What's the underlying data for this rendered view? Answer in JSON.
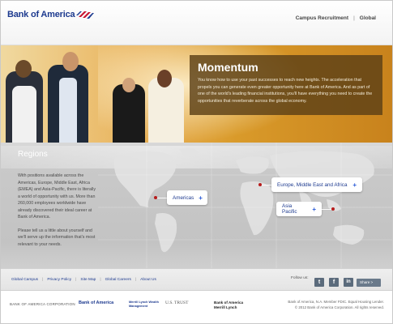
{
  "header": {
    "logo_text": "Bank of America",
    "nav": [
      "Campus Recruitment",
      "Global"
    ]
  },
  "hero": {
    "title": "Momentum",
    "body": "You know how to use your past successes to reach new heights. The acceleration that propels you can generate even greater opportunity here at Bank of America. And as part of one of the world's leading financial institutions, you'll have everything you need to create the opportunities that reverberate across the global economy."
  },
  "regions": {
    "title": "Regions",
    "paragraph1": "With positions available across the Americas, Europe, Middle East, Africa (EMEA) and Asia-Pacific, there is literally a world of opportunity with us. More than 260,000 employees worldwide have already discovered their ideal career at Bank of America.",
    "paragraph2": "Please tell us a little about yourself and we'll serve up the information that's most relevant to your needs.",
    "buttons": [
      {
        "label": "Americas",
        "plus": "+"
      },
      {
        "label": "Europe, Middle East and Africa",
        "plus": "+"
      },
      {
        "label": "Asia Pacific",
        "plus": "+"
      }
    ]
  },
  "footer": {
    "links": [
      "Global Campus",
      "Privacy Policy",
      "Site Map",
      "Global Careers",
      "About Us"
    ],
    "follow_label": "Follow us:",
    "social": [
      {
        "icon": "twitter-icon",
        "glyph": "t"
      },
      {
        "icon": "facebook-icon",
        "glyph": "f"
      },
      {
        "icon": "linkedin-icon",
        "glyph": "in"
      }
    ],
    "share_label": "Share >",
    "corporation": "BANK OF AMERICA CORPORATION",
    "brands": [
      "Bank of America",
      "Merrill Lynch Wealth Management",
      "U.S. TRUST",
      "Bank of America Merrill Lynch"
    ],
    "legal_line1": "Bank of America, N.A. Member FDIC. Equal Housing Lender.",
    "legal_line2": "© 2012 Bank of America Corporation. All rights reserved."
  },
  "colors": {
    "brand_blue": "#1d3a8f",
    "brand_red": "#c8102e",
    "hero_overlay": "#5c4016",
    "accent_plus": "#2a5bd7"
  }
}
